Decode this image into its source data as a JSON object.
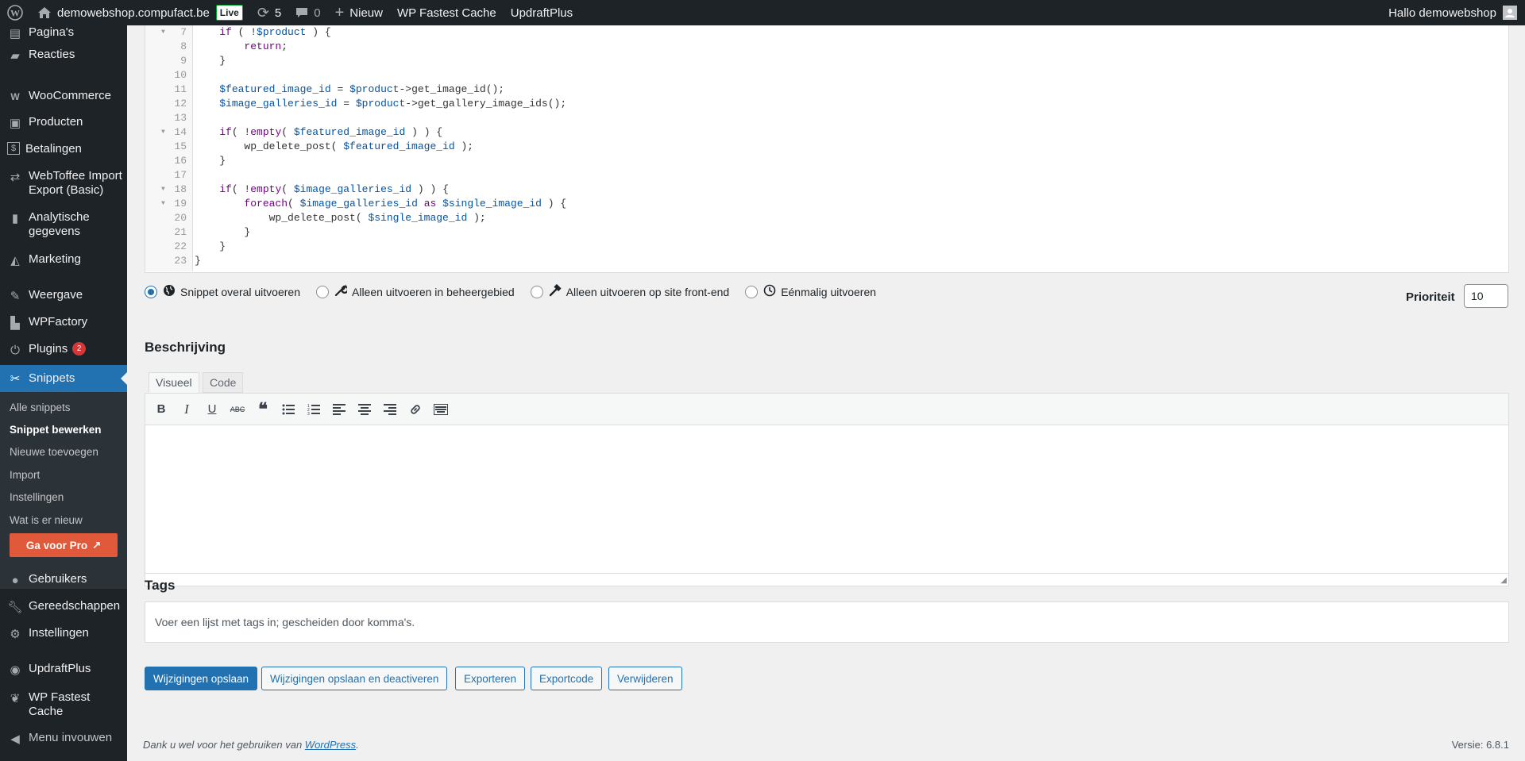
{
  "adminbar": {
    "site_name": "demowebshop.compufact.be",
    "live_label": "Live",
    "updates_count": "5",
    "comments_count": "0",
    "new_label": "Nieuw",
    "plugin1": "WP Fastest Cache",
    "plugin2": "UpdraftPlus",
    "greeting": "Hallo demowebshop"
  },
  "sidebar": {
    "items": [
      {
        "label": "Pagina's",
        "icon": "page-icon"
      },
      {
        "label": "Reacties",
        "icon": "comment-icon"
      },
      {
        "label": "WooCommerce",
        "icon": "woocommerce-icon"
      },
      {
        "label": "Producten",
        "icon": "archive-icon"
      },
      {
        "label": "Betalingen",
        "icon": "dollar-icon"
      },
      {
        "label": "WebToffee Import Export (Basic)",
        "icon": "import-export-icon"
      },
      {
        "label": "Analytische gegevens",
        "icon": "chart-icon"
      },
      {
        "label": "Marketing",
        "icon": "megaphone-icon"
      },
      {
        "label": "Weergave",
        "icon": "brush-icon"
      },
      {
        "label": "WPFactory",
        "icon": "wpfactory-icon"
      },
      {
        "label": "Plugins",
        "icon": "plugin-icon",
        "badge": "2"
      },
      {
        "label": "Snippets",
        "icon": "scissors-icon"
      },
      {
        "label": "Gebruikers",
        "icon": "users-icon"
      },
      {
        "label": "Gereedschappen",
        "icon": "wrench-icon"
      },
      {
        "label": "Instellingen",
        "icon": "settings-icon"
      },
      {
        "label": "UpdraftPlus",
        "icon": "updraft-icon"
      },
      {
        "label": "WP Fastest Cache",
        "icon": "cheetah-icon"
      },
      {
        "label": "Menu invouwen",
        "icon": "collapse-icon"
      }
    ],
    "submenu": [
      "Alle snippets",
      "Snippet bewerken",
      "Nieuwe toevoegen",
      "Import",
      "Instellingen",
      "Wat is er nieuw"
    ],
    "pro_button": "Ga voor Pro"
  },
  "code_lines": [
    {
      "n": "7",
      "fold": true
    },
    {
      "n": "8",
      "fold": false
    },
    {
      "n": "9",
      "fold": false
    },
    {
      "n": "10",
      "fold": false
    },
    {
      "n": "11",
      "fold": false
    },
    {
      "n": "12",
      "fold": false
    },
    {
      "n": "13",
      "fold": false
    },
    {
      "n": "14",
      "fold": true
    },
    {
      "n": "15",
      "fold": false
    },
    {
      "n": "16",
      "fold": false
    },
    {
      "n": "17",
      "fold": false
    },
    {
      "n": "18",
      "fold": true
    },
    {
      "n": "19",
      "fold": true
    },
    {
      "n": "20",
      "fold": false
    },
    {
      "n": "21",
      "fold": false
    },
    {
      "n": "22",
      "fold": false
    },
    {
      "n": "23",
      "fold": false
    }
  ],
  "scope": {
    "options": [
      {
        "label": "Snippet overal uitvoeren",
        "checked": true,
        "icon": "globe-icon"
      },
      {
        "label": "Alleen uitvoeren in beheergebied",
        "checked": false,
        "icon": "wrench-icon"
      },
      {
        "label": "Alleen uitvoeren op site front-end",
        "checked": false,
        "icon": "hammer-icon"
      },
      {
        "label": "Eénmalig uitvoeren",
        "checked": false,
        "icon": "clock-icon"
      }
    ],
    "priority_label": "Prioriteit",
    "priority_value": "10"
  },
  "description": {
    "title": "Beschrijving",
    "tab_visual": "Visueel",
    "tab_code": "Code"
  },
  "tags": {
    "title": "Tags",
    "placeholder": "Voer een lijst met tags in; gescheiden door komma's."
  },
  "actions": {
    "save": "Wijzigingen opslaan",
    "save_deactivate": "Wijzigingen opslaan en deactiveren",
    "export": "Exporteren",
    "export_code": "Exportcode",
    "delete": "Verwijderen"
  },
  "footer": {
    "thanks": "Dank u wel voor het gebruiken van ",
    "wordpress_link": "WordPress",
    "period": ".",
    "version": "Versie: 6.8.1"
  },
  "colors": {
    "accent": "#2271b1",
    "sidebar_bg": "#1d2327",
    "pro_button": "#e0593a"
  }
}
